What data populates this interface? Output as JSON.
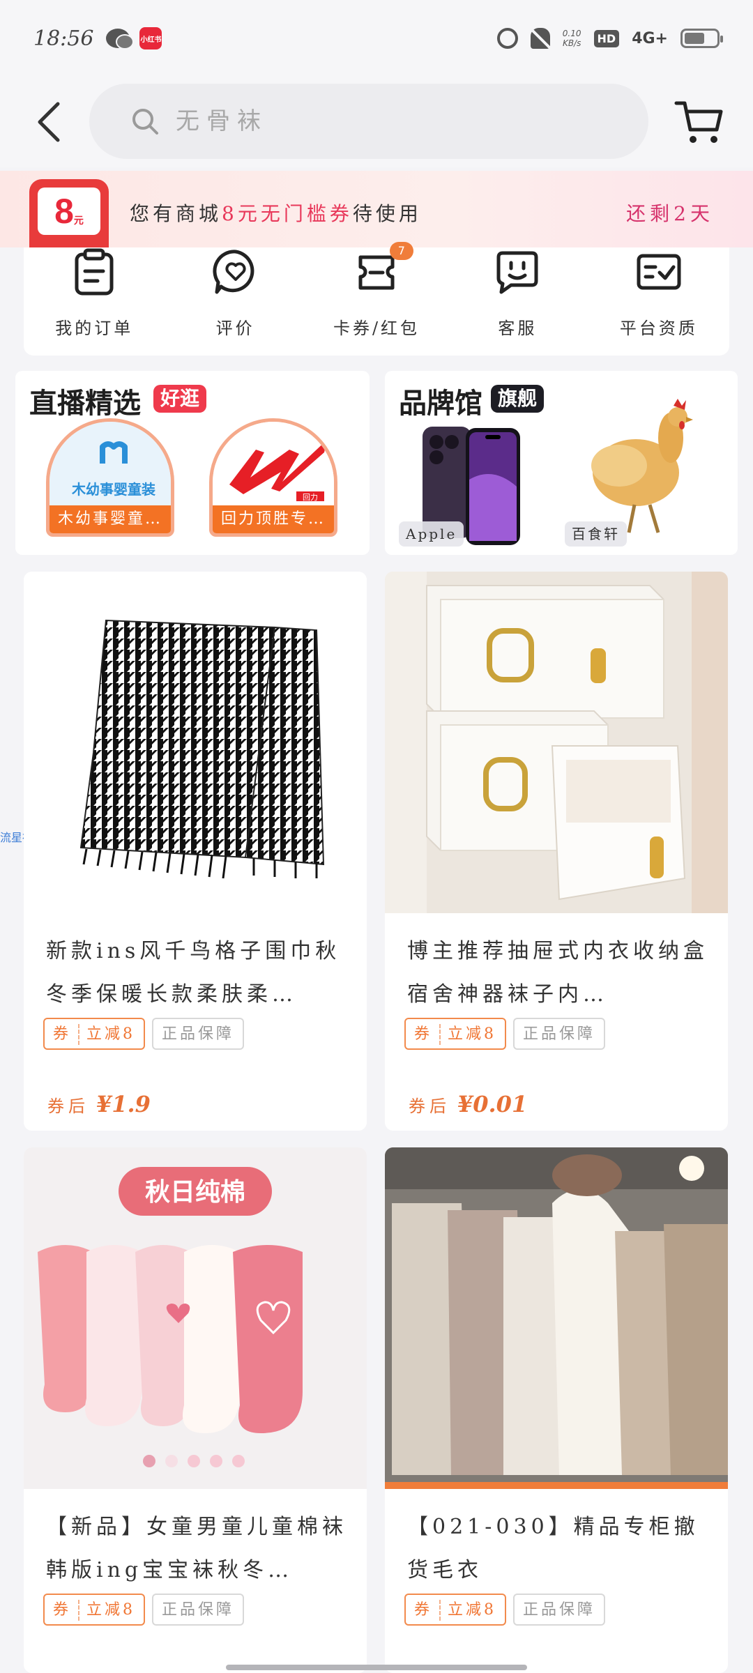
{
  "status_bar": {
    "time": "18:56",
    "shop_badge": "小红书",
    "net_speed_top": "0.10",
    "net_speed_bottom": "KB/s",
    "hd": "HD",
    "signal": "4G+"
  },
  "header": {
    "search_placeholder": "无骨袜"
  },
  "coupon_strip": {
    "icon_amount": "8",
    "icon_unit": "元",
    "text_prefix": "您有商城",
    "text_highlight": "8元无门槛券",
    "text_suffix": "待使用",
    "remaining": "还剩2天"
  },
  "order_menu": {
    "items": [
      {
        "label": "我的订单",
        "icon": "order-list-icon"
      },
      {
        "label": "评价",
        "icon": "review-heart-icon"
      },
      {
        "label": "卡券/红包",
        "icon": "coupon-wallet-icon",
        "badge": "7"
      },
      {
        "label": "客服",
        "icon": "customer-service-icon"
      },
      {
        "label": "平台资质",
        "icon": "certificate-icon"
      }
    ]
  },
  "live_promo": {
    "title": "直播精选",
    "tag": "好逛",
    "items": [
      {
        "logo_text": "木幼事婴童装",
        "caption": "木幼事婴童…"
      },
      {
        "logo_text": "回力",
        "caption": "回力顶胜专…"
      }
    ]
  },
  "brand_promo": {
    "title": "品牌馆",
    "tag": "旗舰",
    "items": [
      {
        "caption": "Apple"
      },
      {
        "caption": "百食轩"
      }
    ]
  },
  "side_label": "流星社区",
  "products": [
    {
      "title": "新款ins风千鸟格子围巾秋冬季保暖长款柔肤柔…",
      "coupon_tag_left": "券",
      "coupon_tag_right": "立减8",
      "guarantee": "正品保障",
      "price_label": "券后",
      "price": "¥1.9"
    },
    {
      "title": "博主推荐抽屉式内衣收纳盒宿舍神器袜子内…",
      "coupon_tag_left": "券",
      "coupon_tag_right": "立减8",
      "guarantee": "正品保障",
      "price_label": "券后",
      "price": "¥0.01"
    },
    {
      "title": "【新品】女童男童儿童棉袜韩版ing宝宝袜秋冬…",
      "image_banner": "秋日纯棉",
      "coupon_tag_left": "券",
      "coupon_tag_right": "立减8",
      "guarantee": "正品保障"
    },
    {
      "title": "【021-030】精品专柜撤货毛衣",
      "coupon_tag_left": "券",
      "coupon_tag_right": "立减8",
      "guarantee": "正品保障"
    }
  ]
}
